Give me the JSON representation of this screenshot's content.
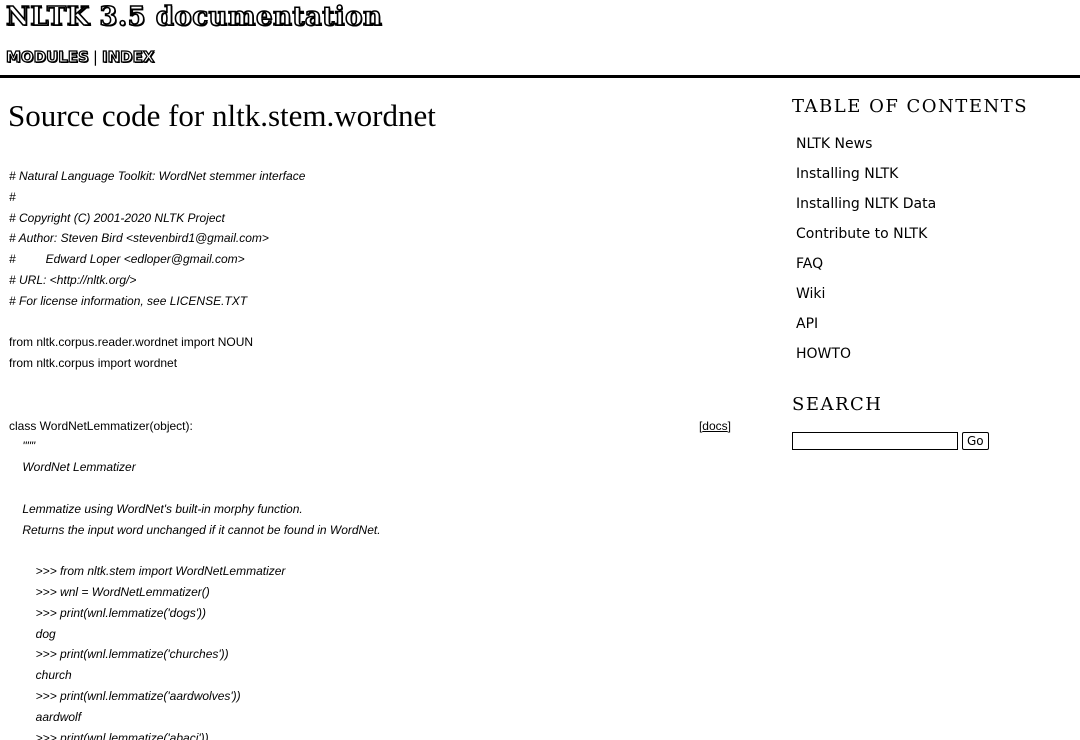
{
  "header": {
    "title": "NLTK 3.5 documentation",
    "nav": {
      "modules": "MODULES",
      "separator": "|",
      "index": "INDEX"
    }
  },
  "main": {
    "page_title": "Source code for nltk.stem.wordnet",
    "code_lines": [
      {
        "text": "# Natural Language Toolkit: WordNet stemmer interface",
        "kind": "c"
      },
      {
        "text": "#",
        "kind": "c"
      },
      {
        "text": "# Copyright (C) 2001-2020 NLTK Project",
        "kind": "c"
      },
      {
        "text": "# Author: Steven Bird <stevenbird1@gmail.com>",
        "kind": "c"
      },
      {
        "text": "#         Edward Loper <edloper@gmail.com>",
        "kind": "c"
      },
      {
        "text": "# URL: <http://nltk.org/>",
        "kind": "c"
      },
      {
        "text": "# For license information, see LICENSE.TXT",
        "kind": "c"
      },
      {
        "text": "",
        "kind": "n"
      },
      {
        "text": "from nltk.corpus.reader.wordnet import NOUN",
        "kind": "n"
      },
      {
        "text": "from nltk.corpus import wordnet",
        "kind": "n"
      },
      {
        "text": "",
        "kind": "n"
      },
      {
        "text": "",
        "kind": "n"
      },
      {
        "text": "class WordNetLemmatizer(object):",
        "kind": "n",
        "docs": true
      },
      {
        "text": "    \"\"\"",
        "kind": "s"
      },
      {
        "text": "    WordNet Lemmatizer",
        "kind": "s"
      },
      {
        "text": "",
        "kind": "s"
      },
      {
        "text": "    Lemmatize using WordNet's built-in morphy function.",
        "kind": "s"
      },
      {
        "text": "    Returns the input word unchanged if it cannot be found in WordNet.",
        "kind": "s"
      },
      {
        "text": "",
        "kind": "s"
      },
      {
        "text": "        >>> from nltk.stem import WordNetLemmatizer",
        "kind": "s"
      },
      {
        "text": "        >>> wnl = WordNetLemmatizer()",
        "kind": "s"
      },
      {
        "text": "        >>> print(wnl.lemmatize('dogs'))",
        "kind": "s"
      },
      {
        "text": "        dog",
        "kind": "s"
      },
      {
        "text": "        >>> print(wnl.lemmatize('churches'))",
        "kind": "s"
      },
      {
        "text": "        church",
        "kind": "s"
      },
      {
        "text": "        >>> print(wnl.lemmatize('aardwolves'))",
        "kind": "s"
      },
      {
        "text": "        aardwolf",
        "kind": "s"
      },
      {
        "text": "        >>> print(wnl.lemmatize('abaci'))",
        "kind": "s"
      }
    ],
    "docs_link": {
      "open": "[",
      "label": "docs",
      "close": "]"
    }
  },
  "sidebar": {
    "toc_title": "TABLE OF CONTENTS",
    "toc_items": [
      "NLTK News",
      "Installing NLTK",
      "Installing NLTK Data",
      "Contribute to NLTK",
      "FAQ",
      "Wiki",
      "API",
      "HOWTO"
    ],
    "search_title": "SEARCH",
    "search_value": "",
    "search_button": "Go"
  }
}
